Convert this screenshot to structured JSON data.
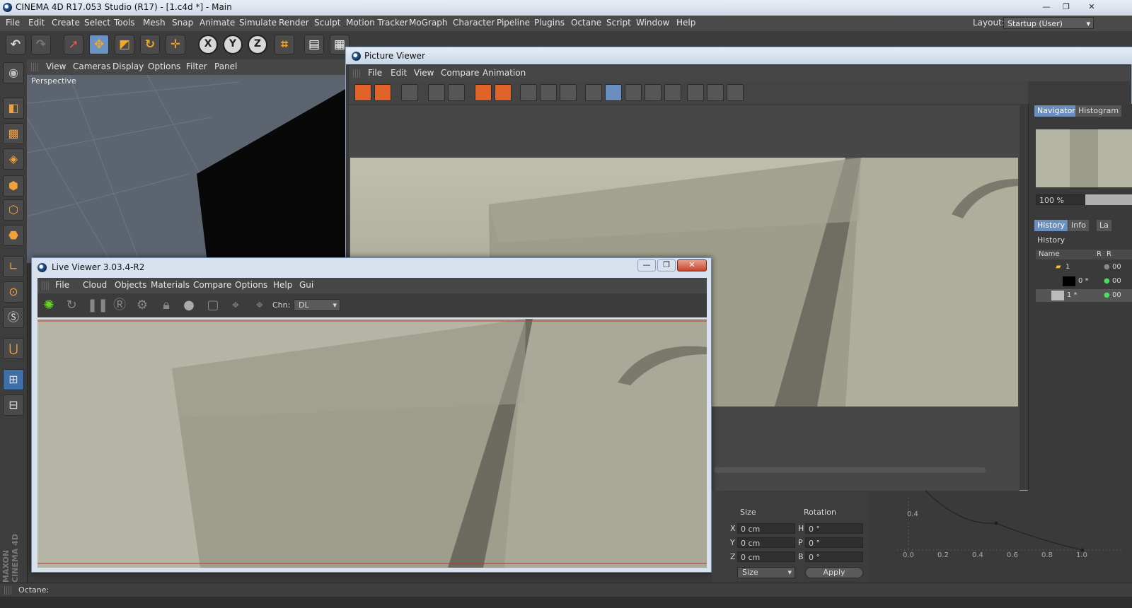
{
  "app": {
    "title": "CINEMA 4D R17.053 Studio (R17) - [1.c4d *] - Main",
    "menus": [
      "File",
      "Edit",
      "Create",
      "Select",
      "Tools",
      "Mesh",
      "Snap",
      "Animate",
      "Simulate",
      "Render",
      "Sculpt",
      "Motion Tracker",
      "MoGraph",
      "Character",
      "Pipeline",
      "Plugins",
      "Octane",
      "Script",
      "Window",
      "Help"
    ],
    "layout_label": "Layout:",
    "layout_value": "Startup (User)",
    "window_buttons": [
      "—",
      "❐",
      "✕"
    ],
    "axis_buttons": [
      "X",
      "Y",
      "Z"
    ],
    "maxon_brand": "MAXON CINEMA 4D",
    "accent_color": "#f5a623",
    "selected_tool_color": "#6a93c4"
  },
  "viewport": {
    "menus": [
      "View",
      "Cameras",
      "Display",
      "Options",
      "Filter",
      "Panel"
    ],
    "label": "Perspective"
  },
  "picture_viewer": {
    "title": "Picture Viewer",
    "menus": [
      "File",
      "Edit",
      "View",
      "Compare",
      "Animation"
    ],
    "side_tabs_top": [
      "Navigator",
      "Histogram"
    ],
    "zoom_value": "100 %",
    "side_tabs_mid": [
      "History",
      "Info",
      "La"
    ],
    "history_label": "History",
    "history_header": {
      "name": "Name",
      "r": "R",
      "c": "R"
    },
    "history_rows": [
      {
        "name": "1",
        "status": "00"
      },
      {
        "name": "0 *",
        "status": "00"
      },
      {
        "name": "1 *",
        "status": "00"
      }
    ]
  },
  "live_viewer": {
    "title": "Live Viewer 3.03.4-R2",
    "menus": [
      "File",
      "Cloud",
      "Objects",
      "Materials",
      "Compare",
      "Options",
      "Help",
      "Gui"
    ],
    "channel_label": "Chn:",
    "channel_value": "DL"
  },
  "attributes": {
    "headers": {
      "size": "Size",
      "rotation": "Rotation"
    },
    "rows": [
      {
        "axis": "X",
        "size": "0 cm",
        "rot_label": "H",
        "rot": "0 °"
      },
      {
        "axis": "Y",
        "size": "0 cm",
        "rot_label": "P",
        "rot": "0 °"
      },
      {
        "axis": "Z",
        "size": "0 cm",
        "rot_label": "B",
        "rot": "0 °"
      }
    ],
    "mode_select": "Size",
    "apply_label": "Apply"
  },
  "graph": {
    "y_tick": "0.4",
    "x_ticks": [
      "0.0",
      "0.2",
      "0.4",
      "0.6",
      "0.8",
      "1.0"
    ]
  },
  "status": {
    "text": "Octane:"
  }
}
